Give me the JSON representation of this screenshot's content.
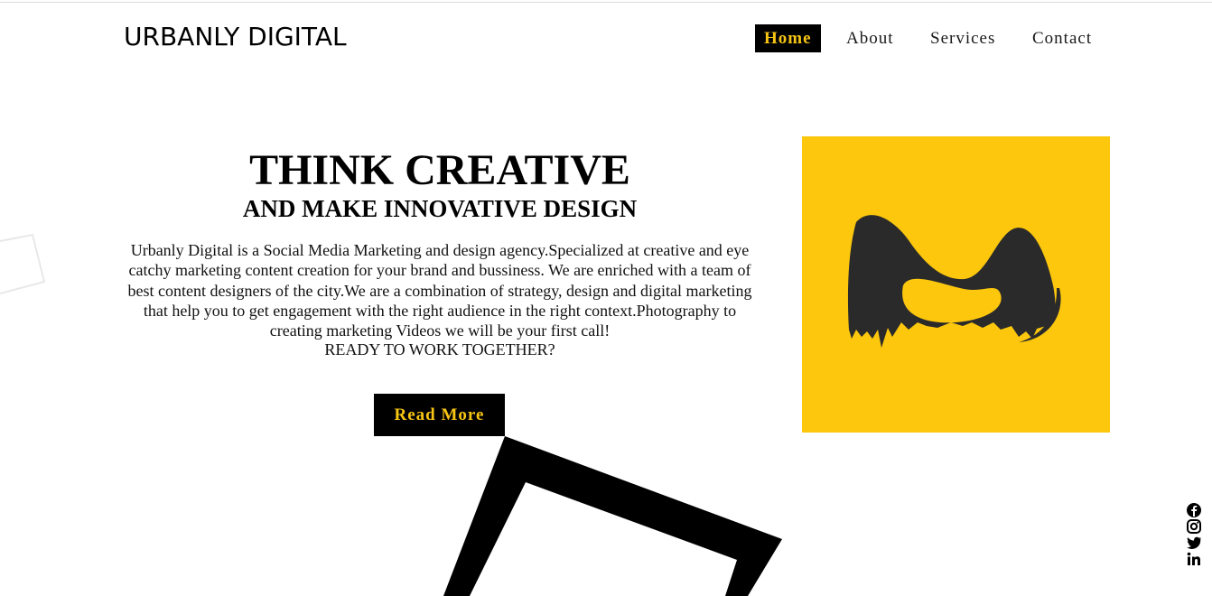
{
  "header": {
    "brand": "URBANLY DIGITAL",
    "nav": [
      {
        "label": "Home",
        "active": true
      },
      {
        "label": "About",
        "active": false
      },
      {
        "label": "Services",
        "active": false
      },
      {
        "label": "Contact",
        "active": false
      }
    ]
  },
  "hero": {
    "title": "THINK CREATIVE",
    "subtitle": "AND MAKE INNOVATIVE DESIGN",
    "description": "Urbanly Digital is a Social Media Marketing and design agency.Specialized at creative and eye catchy marketing content creation for your brand and bussiness. We are enriched with a team of best content designers of the city.We are a combination of strategy, design and digital marketing that help you to get engagement with the right audience in the right context.Photography to creating marketing Videos we will be your first call!",
    "cta_text": "READY TO WORK TOGETHER?",
    "button_label": "Read More"
  },
  "brand_card": {
    "icon": "urbanly-m-logo-icon",
    "background": "#fcc70d",
    "mark_color": "#2a2a2a"
  },
  "social": [
    {
      "icon": "facebook-icon"
    },
    {
      "icon": "instagram-icon"
    },
    {
      "icon": "twitter-icon"
    },
    {
      "icon": "linkedin-icon"
    }
  ],
  "colors": {
    "accent": "#f7c514",
    "text": "#000000",
    "background": "#ffffff"
  }
}
